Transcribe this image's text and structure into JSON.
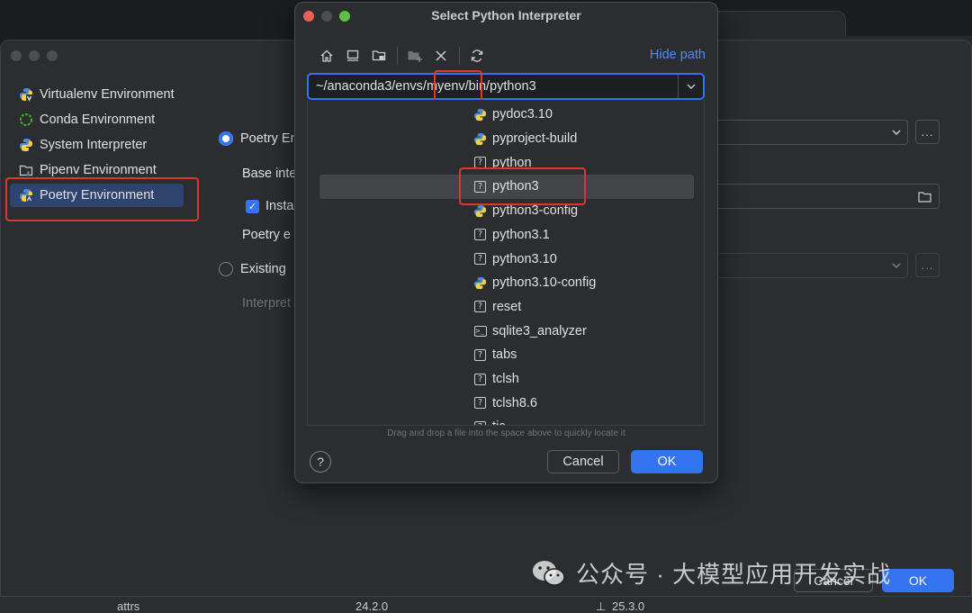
{
  "dialog": {
    "title": "Select Python Interpreter",
    "hide_path": "Hide path",
    "path_value": "~/anaconda3/envs/myenv/bin/python3",
    "hint": "Drag and drop a file into the space above to quickly locate it",
    "help": "?",
    "cancel": "Cancel",
    "ok": "OK",
    "files": [
      {
        "name": "pydoc3.10",
        "icon": "python-icon"
      },
      {
        "name": "pyproject-build",
        "icon": "python-icon"
      },
      {
        "name": "python",
        "icon": "unknown-file-icon"
      },
      {
        "name": "python3",
        "icon": "unknown-file-icon",
        "selected": true
      },
      {
        "name": "python3-config",
        "icon": "python-icon"
      },
      {
        "name": "python3.1",
        "icon": "unknown-file-icon"
      },
      {
        "name": "python3.10",
        "icon": "unknown-file-icon"
      },
      {
        "name": "python3.10-config",
        "icon": "python-icon"
      },
      {
        "name": "reset",
        "icon": "unknown-file-icon"
      },
      {
        "name": "sqlite3_analyzer",
        "icon": "terminal-icon"
      },
      {
        "name": "tabs",
        "icon": "unknown-file-icon"
      },
      {
        "name": "tclsh",
        "icon": "unknown-file-icon"
      },
      {
        "name": "tclsh8.6",
        "icon": "unknown-file-icon"
      },
      {
        "name": "tic",
        "icon": "unknown-file-icon"
      }
    ]
  },
  "environments": [
    {
      "label": "Virtualenv Environment",
      "icon": "virtualenv-icon"
    },
    {
      "label": "Conda Environment",
      "icon": "conda-icon"
    },
    {
      "label": "System Interpreter",
      "icon": "python-icon"
    },
    {
      "label": "Pipenv Environment",
      "icon": "pipenv-icon"
    },
    {
      "label": "Poetry Environment",
      "icon": "poetry-icon",
      "selected": true
    }
  ],
  "poetry_panel": {
    "radio_new": "Poetry En",
    "base_interpreter": "Base inte",
    "install_checkbox": "Insta",
    "poetry_executable": "Poetry e",
    "radio_existing": "Existing",
    "interpreter": "Interpret",
    "browse": "..."
  },
  "background_buttons": {
    "cancel": "Cancel",
    "ok": "OK"
  },
  "bottom_row": {
    "package": "attrs",
    "version": "24.2.0",
    "latest": "25.3.0"
  },
  "watermark": "公众号 · 大模型应用开发实战",
  "colors": {
    "accent": "#3574f0",
    "highlight": "#e0372c",
    "link": "#4d8bf5"
  }
}
